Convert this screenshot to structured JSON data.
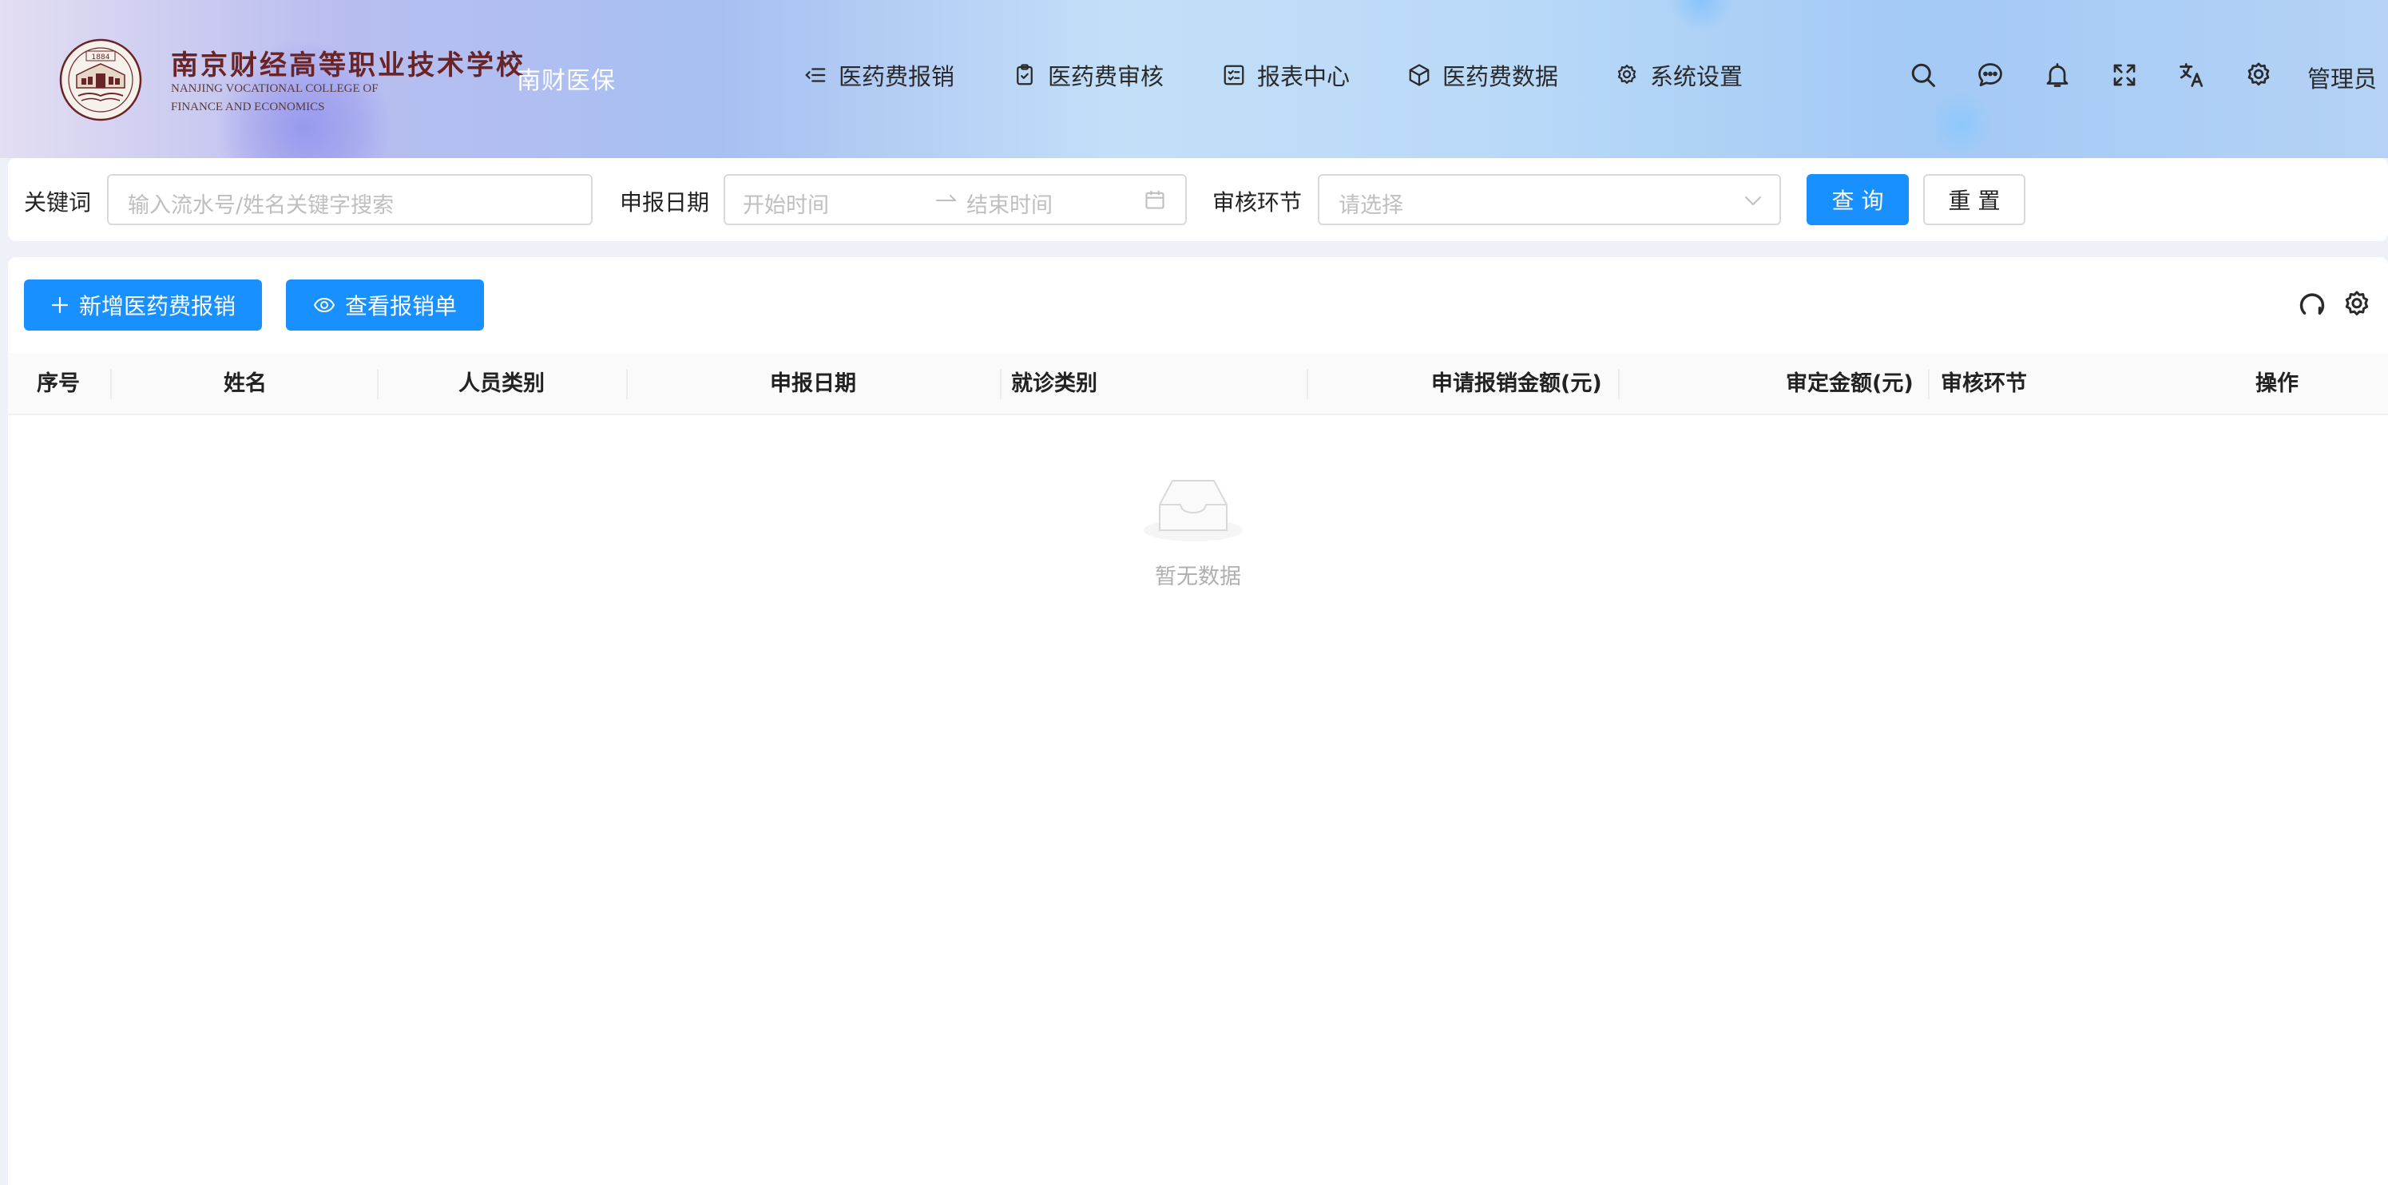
{
  "header": {
    "school_name_cn": "南京财经高等职业技术学校",
    "school_name_en_line1": "NANJING VOCATIONAL COLLEGE OF",
    "school_name_en_line2": "FINANCE AND ECONOMICS",
    "logo_year": "1884",
    "app_name": "南财医保",
    "nav": [
      {
        "label": "医药费报销",
        "icon": "list-indent-icon"
      },
      {
        "label": "医药费审核",
        "icon": "clipboard-check-icon"
      },
      {
        "label": "报表中心",
        "icon": "checklist-icon"
      },
      {
        "label": "医药费数据",
        "icon": "cube-icon"
      },
      {
        "label": "系统设置",
        "icon": "gear-icon"
      }
    ],
    "tools": [
      "search-icon",
      "message-icon",
      "bell-icon",
      "fullscreen-icon",
      "translate-icon",
      "gear-icon"
    ],
    "user": "管理员"
  },
  "search": {
    "keyword_label": "关键词",
    "keyword_placeholder": "输入流水号/姓名关键字搜索",
    "date_label": "申报日期",
    "start_placeholder": "开始时间",
    "end_placeholder": "结束时间",
    "stage_label": "审核环节",
    "stage_placeholder": "请选择",
    "query_button": "查 询",
    "reset_button": "重 置"
  },
  "toolbar": {
    "add_button": "新增医药费报销",
    "view_button": "查看报销单"
  },
  "table": {
    "columns": [
      "序号",
      "姓名",
      "人员类别",
      "申报日期",
      "就诊类别",
      "申请报销金额(元)",
      "审定金额(元)",
      "审核环节",
      "操作"
    ],
    "rows": [],
    "empty_text": "暂无数据"
  },
  "colors": {
    "primary": "#1890ff",
    "border": "#d9d9d9",
    "placeholder": "#bfbfbf",
    "school_red": "#6b2426"
  }
}
